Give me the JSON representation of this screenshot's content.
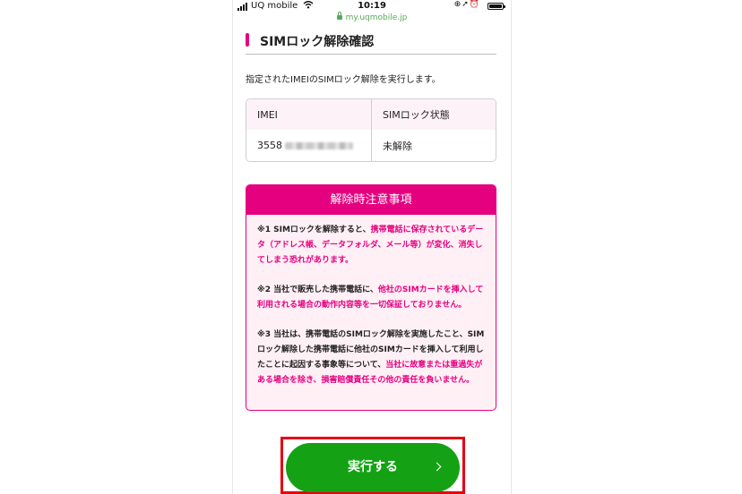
{
  "status_bar": {
    "carrier": "UQ mobile",
    "time": "10:19",
    "icons": [
      "signal-icon",
      "wifi-icon",
      "orientation-lock-icon",
      "location-icon",
      "alarm-icon",
      "battery-icon"
    ]
  },
  "url_bar": {
    "url": "my.uqmobile.jp",
    "secure": true
  },
  "page": {
    "title": "SIMロック解除確認",
    "intro": "指定されたIMEIのSIMロック解除を実行します。"
  },
  "table": {
    "headers": [
      "IMEI",
      "SIMロック状態"
    ],
    "row": {
      "imei_prefix": "3558",
      "status": "未解除"
    }
  },
  "notice": {
    "title": "解除時注意事項",
    "items": [
      {
        "plain": "※1 SIMロックを解除すると、",
        "highlight": "携帯電話に保存されているデータ（アドレス帳、データフォルダ、メール等）が変化、消失してしまう恐れがあります。",
        "tail": ""
      },
      {
        "plain": "※2 当社で販売した携帯電話に、",
        "highlight": "他社のSIMカードを挿入して利用される場合の動作内容等を一切保証しておりません。",
        "tail": ""
      },
      {
        "plain": "※3 当社は、携帯電話のSIMロック解除を実施したこと、SIMロック解除した携帯電話に他社のSIMカードを挿入して利用したことに起因する事象等について、",
        "highlight": "当社に故意または重過失がある場合を除き、損害賠償責任その他の責任を負いません。",
        "tail": ""
      }
    ]
  },
  "execute_button": {
    "label": "実行する"
  },
  "colors": {
    "accent": "#e5007f",
    "button": "#14a214",
    "highlight_frame": "#e60012",
    "url_green": "#5aa85a"
  }
}
